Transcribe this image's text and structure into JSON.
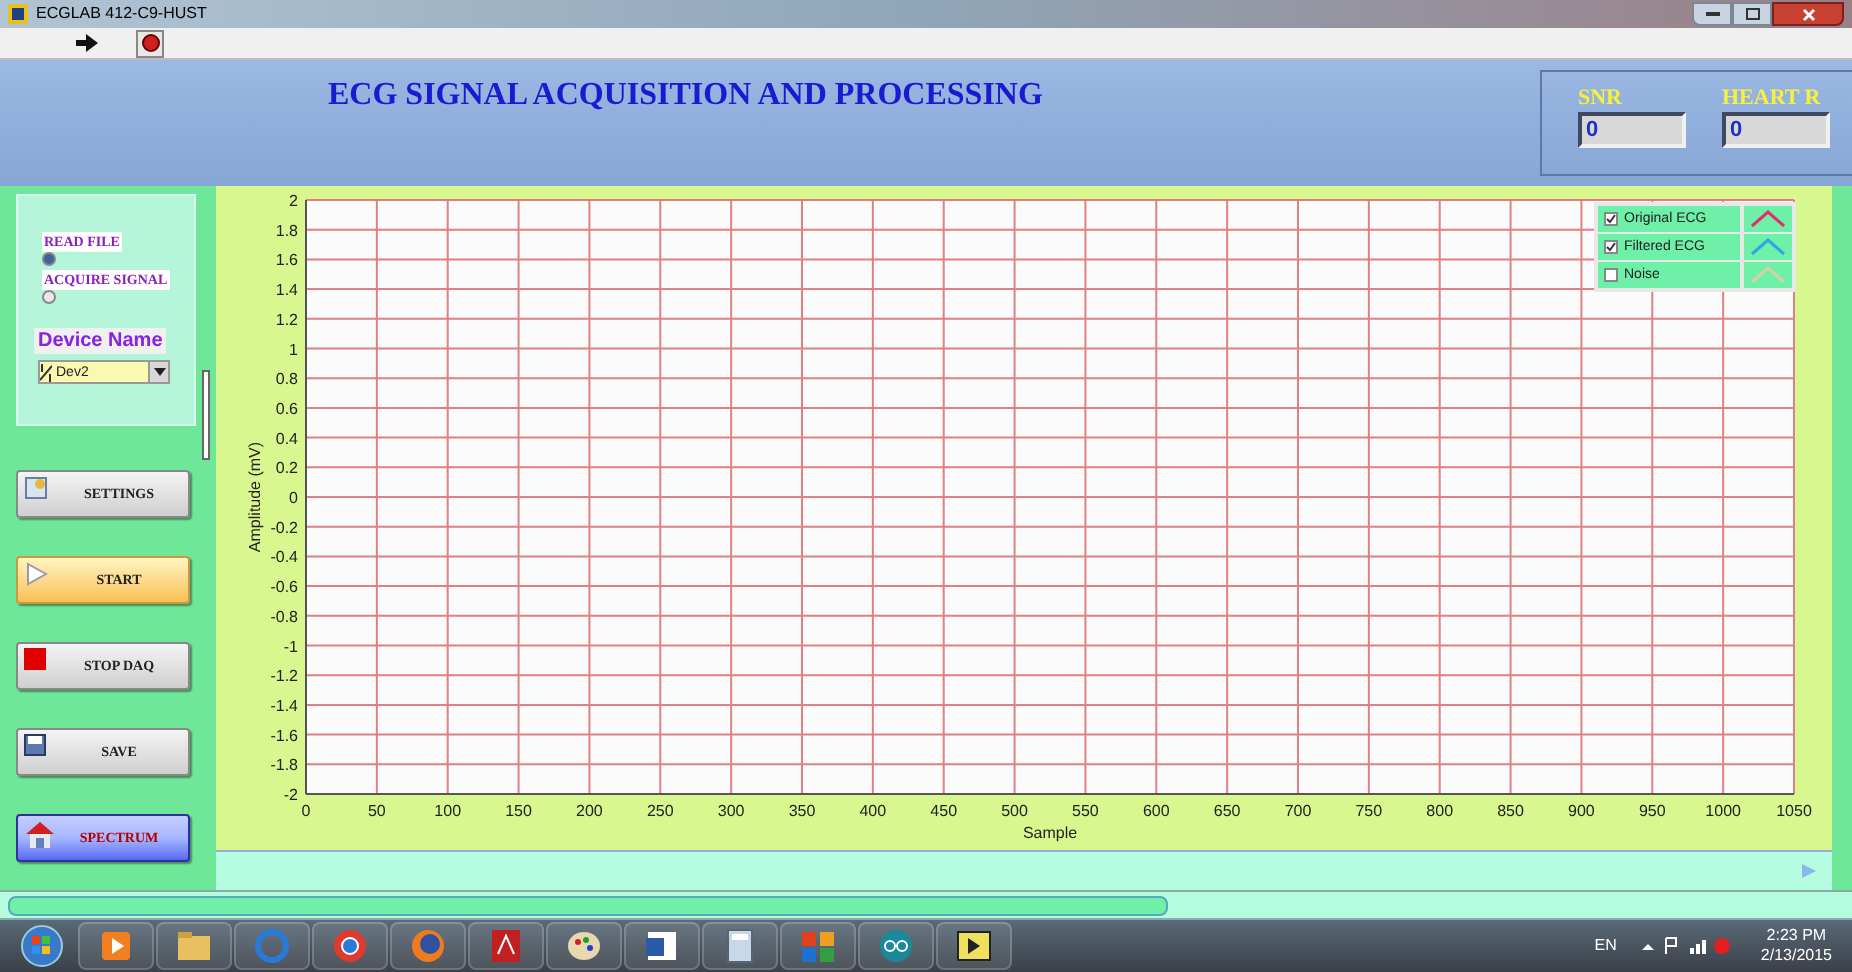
{
  "window": {
    "title": "ECGLAB 412-C9-HUST"
  },
  "header": {
    "title": "ECG SIGNAL ACQUISITION AND PROCESSING",
    "indicators": [
      {
        "label": "SNR",
        "value": "0"
      },
      {
        "label": "HEART R",
        "value": "0"
      }
    ]
  },
  "source": {
    "options": [
      {
        "label": "READ FILE",
        "selected": true
      },
      {
        "label": "ACQUIRE SIGNAL",
        "selected": false
      }
    ],
    "device_label": "Device Name",
    "device_value": "Dev2"
  },
  "buttons": [
    {
      "kind": "settings",
      "label": "SETTINGS"
    },
    {
      "kind": "start",
      "label": "START"
    },
    {
      "kind": "stop",
      "label": "STOP DAQ"
    },
    {
      "kind": "save",
      "label": "SAVE"
    },
    {
      "kind": "spectrum",
      "label": "SPECTRUM"
    }
  ],
  "chart": {
    "legend": [
      {
        "label": "Original ECG",
        "checked": true,
        "color": "#e0306a"
      },
      {
        "label": "Filtered ECG",
        "checked": true,
        "color": "#2aa8e0"
      },
      {
        "label": "Noise",
        "checked": false,
        "color": "#d8d0a0"
      }
    ],
    "chart_data": {
      "type": "line",
      "grid": true,
      "xlabel": "Sample",
      "ylabel": "Amplitude (mV)",
      "xlim": [
        0,
        1050
      ],
      "ylim": [
        -2,
        2
      ],
      "xticks": [
        0,
        50,
        100,
        150,
        200,
        250,
        300,
        350,
        400,
        450,
        500,
        550,
        600,
        650,
        700,
        750,
        800,
        850,
        900,
        950,
        1000,
        1050
      ],
      "yticks": [
        {
          "value": 2,
          "label": "2"
        },
        {
          "value": 1.8,
          "label": "1.8"
        },
        {
          "value": 1.6,
          "label": "1.6"
        },
        {
          "value": 1.4,
          "label": "1.4"
        },
        {
          "value": 1.2,
          "label": "1.2"
        },
        {
          "value": 1,
          "label": "1"
        },
        {
          "value": 0.8,
          "label": "0.8"
        },
        {
          "value": 0.6,
          "label": "0.6"
        },
        {
          "value": 0.4,
          "label": "0.4"
        },
        {
          "value": 0.2,
          "label": "0.2"
        },
        {
          "value": 0,
          "label": "0"
        },
        {
          "value": -0.2,
          "label": "-0.2"
        },
        {
          "value": -0.4,
          "label": "-0.4"
        },
        {
          "value": -0.6,
          "label": "-0.6"
        },
        {
          "value": -0.8,
          "label": "-0.8"
        },
        {
          "value": -1,
          "label": "-1"
        },
        {
          "value": -1.2,
          "label": "-1.2"
        },
        {
          "value": -1.4,
          "label": "-1.4"
        },
        {
          "value": -1.6,
          "label": "-1.6"
        },
        {
          "value": -1.8,
          "label": "-1.8"
        },
        {
          "value": -2,
          "label": "-2"
        }
      ]
    }
  },
  "taskbar": {
    "language": "EN",
    "time": "2:23 PM",
    "date": "2/13/2015"
  }
}
